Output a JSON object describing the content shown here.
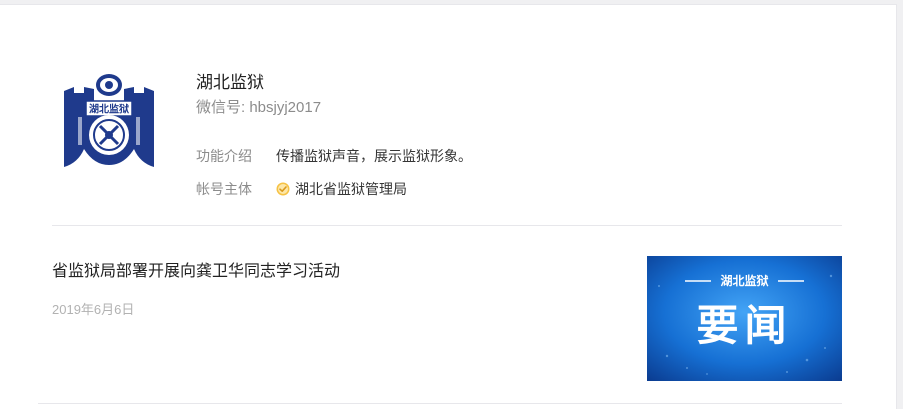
{
  "account": {
    "name": "湖北监狱",
    "wechat_id": "微信号: hbsjyj2017",
    "intro_label": "功能介绍",
    "intro_value": "传播监狱声音，展示监狱形象。",
    "owner_label": "帐号主体",
    "owner_value": "湖北省监狱管理局",
    "logo_text": "湖北监狱",
    "logo_icon": "prison-emblem-icon",
    "verified_icon": "verified-check-icon"
  },
  "articles": [
    {
      "title": "省监狱局部署开展向龚卫华同志学习活动",
      "date": "2019年6月6日",
      "thumb_subtitle": "湖北监狱",
      "thumb_title": "要闻"
    }
  ],
  "colors": {
    "logo_blue": "#1f3a8c",
    "verified": "#f6c244",
    "thumb_bg": "#1670d4"
  }
}
